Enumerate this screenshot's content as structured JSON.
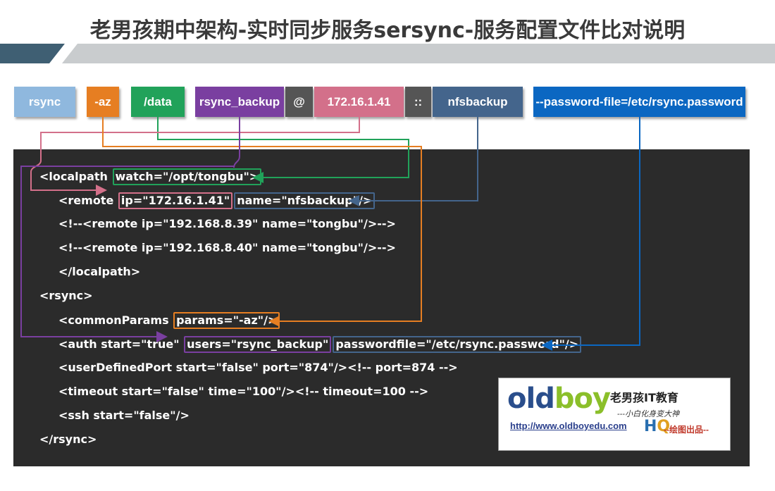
{
  "title": "老男孩期中架构-实时同步服务sersync-服务配置文件比对说明",
  "tokens": [
    {
      "label": "rsync",
      "color": "#8fb8de"
    },
    {
      "label": "-az",
      "color": "#e67e22"
    },
    {
      "label": "/data",
      "color": "#21a25a"
    },
    {
      "label": "rsync_backup",
      "color": "#7a3fa0"
    },
    {
      "label": "@",
      "color": "#555555"
    },
    {
      "label": "172.16.1.41",
      "color": "#d3708a"
    },
    {
      "label": "::",
      "color": "#555555"
    },
    {
      "label": "nfsbackup",
      "color": "#44658c"
    },
    {
      "label": "--password-file=/etc/rsync.password",
      "color": "#0b67c2"
    }
  ],
  "code": {
    "l1_pre": "<localpath ",
    "l1_hl": "watch=\"/opt/tongbu\">",
    "l2_pre": "<remote ",
    "l2_hl1": "ip=\"172.16.1.41\"",
    "l2_hl2": "name=\"nfsbackup\"/>",
    "l3": "<!--<remote ip=\"192.168.8.39\" name=\"tongbu\"/>-->",
    "l4": "<!--<remote ip=\"192.168.8.40\" name=\"tongbu\"/>-->",
    "l5": "</localpath>",
    "l6": "<rsync>",
    "l7_pre": "<commonParams ",
    "l7_hl": "params=\"-az\"/>",
    "l8_pre": "<auth start=\"true\" ",
    "l8_hl1": "users=\"rsync_backup\"",
    "l8_hl2": "passwordfile=\"/etc/rsync.password\"/>",
    "l9": "<userDefinedPort start=\"false\" port=\"874\"/><!-- port=874 -->",
    "l10": "<timeout start=\"false\" time=\"100\"/><!-- timeout=100 -->",
    "l11": "<ssh start=\"false\"/>",
    "l12": "</rsync>"
  },
  "logo": {
    "brand_a": "old",
    "brand_b": "boy",
    "cn": "老男孩IT教育",
    "slogan": "---小白化身变大神",
    "url": "http://www.oldboyedu.com",
    "hq_h": "H",
    "hq_q": "Q",
    "credit": "--绘图出品--"
  },
  "colors": {
    "watch": "#21a25a",
    "ip": "#d3708a",
    "name": "#44658c",
    "params": "#e67e22",
    "users": "#7a3fa0",
    "passwordfile": "#0b67c2",
    "panel": "#2b2b2b",
    "brand_blue": "#2a4e8c",
    "brand_green": "#8bbf2a"
  }
}
